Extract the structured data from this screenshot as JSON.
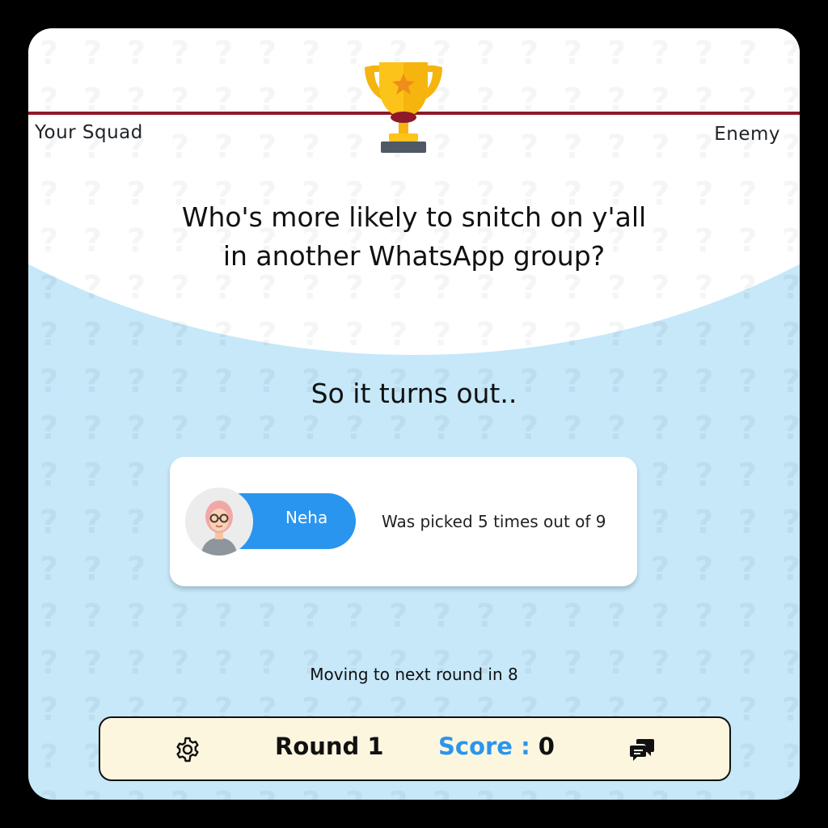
{
  "header": {
    "left_team": "Your Squad",
    "right_team": "Enemy",
    "trophy_icon": "trophy-icon",
    "rope_color": "#8d1a2a"
  },
  "question": {
    "line1": "Who's more likely to snitch on y'all",
    "line2": "in another WhatsApp group?"
  },
  "reveal": {
    "title": "So it turns out..",
    "player_name": "Neha",
    "avatar_icon": "avatar-woman-glasses-icon",
    "picked_text": "Was picked 5 times out of 9"
  },
  "countdown": {
    "text": "Moving to next round in 8"
  },
  "bottom_bar": {
    "settings_icon": "gear-icon",
    "round_label": "Round 1",
    "score_label": "Score :",
    "score_value": "0",
    "chat_icon": "chat-bubbles-icon"
  },
  "colors": {
    "background": "#c6e8f9",
    "accent": "#2a95ee",
    "bar_background": "#fdf6df",
    "frame": "#000000"
  }
}
